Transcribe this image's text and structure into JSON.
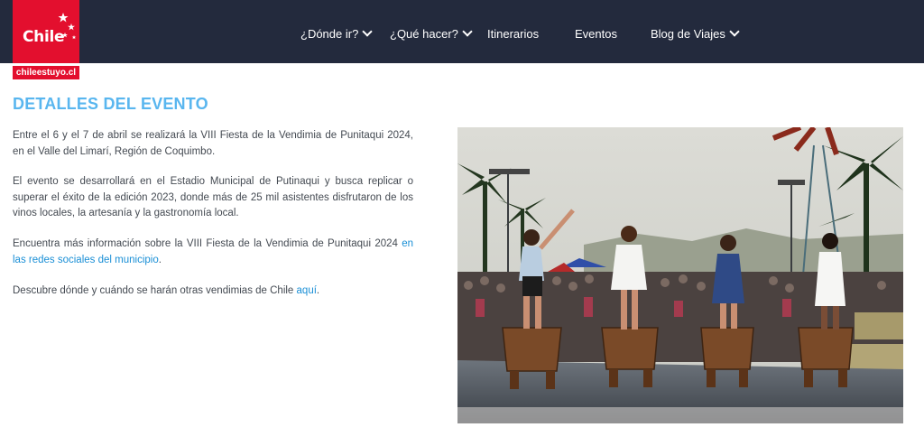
{
  "header": {
    "logo_text": "Chile",
    "site_tag": "chileestuyo.cl",
    "nav": [
      {
        "label": "¿Dónde ir?"
      },
      {
        "label": "¿Qué hacer?"
      },
      {
        "label": "Itinerarios"
      },
      {
        "label": "Eventos"
      },
      {
        "label": "Blog de Viajes"
      }
    ]
  },
  "colors": {
    "topbar": "#232a3d",
    "brand_red": "#e30f2e",
    "title_blue": "#59b6ef",
    "link_blue": "#1a8fd6",
    "text_gray": "#444a52"
  },
  "icons": [
    "chile-logo-stars-icon",
    "chevron-down-icon"
  ],
  "main": {
    "title": "DETALLES DEL EVENTO",
    "p1": "Entre el 6 y el 7 de abril se realizará la  VIII Fiesta de la Vendimia de Punitaqui 2024, en el Valle del Limarí, Región de Coquimbo.",
    "p2": "El evento se desarrollará en el Estadio Municipal de Putinaqui y busca replicar o superar el éxito de la edición 2023, donde más de 25 mil asistentes disfrutaron de los vinos locales, la artesanía y la gastronomía local.",
    "p3_text": "Encuentra más información sobre la VIII Fiesta de la Vendimia de Punitaqui 2024 ",
    "p3_link": "en las redes sociales del municipio",
    "p3_end": ".",
    "p4_text": "Descubre dónde y cuándo se harán otras vendimias de Chile ",
    "p4_link": "aquí",
    "p4_end": "."
  }
}
